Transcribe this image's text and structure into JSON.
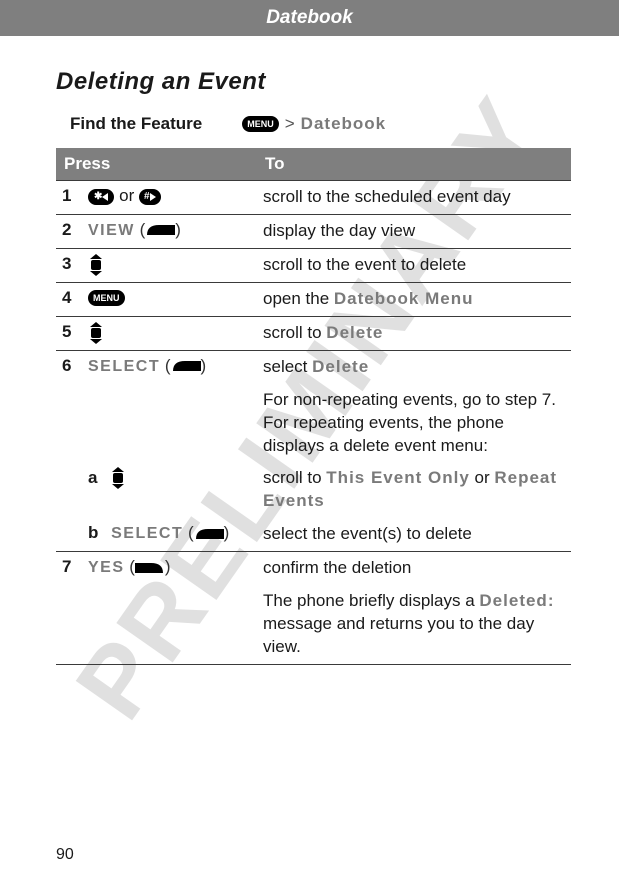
{
  "watermark": "PRELIMINARY",
  "header": {
    "title": "Datebook"
  },
  "section": {
    "heading": "Deleting an  Event"
  },
  "find": {
    "label": "Find the Feature",
    "menu_key_label": "MENU",
    "gt": ">",
    "path_end": "Datebook"
  },
  "table": {
    "col_press": "Press",
    "col_to": "To"
  },
  "icons": {
    "star": "✱",
    "hash": "#",
    "or": "or"
  },
  "steps": {
    "s1": {
      "n": "1",
      "to": "scroll to the scheduled event day"
    },
    "s2": {
      "n": "2",
      "press": "VIEW",
      "to": "display the day view"
    },
    "s3": {
      "n": "3",
      "to": "scroll to the event to delete"
    },
    "s4": {
      "n": "4",
      "to_a": "open the ",
      "to_b": "Datebook Menu"
    },
    "s5": {
      "n": "5",
      "to_a": "scroll to ",
      "to_b": "Delete"
    },
    "s6": {
      "n": "6",
      "press": "SELECT",
      "to_a": "select ",
      "to_b": "Delete",
      "note": "For non-repeating events, go to step 7. For repeating events, the phone displays a delete event menu:"
    },
    "s6a": {
      "n": "a",
      "to_a": "scroll to ",
      "to_b": "This Event Only",
      "to_c": " or ",
      "to_d": "Repeat Events"
    },
    "s6b": {
      "n": "b",
      "press": "SELECT",
      "to": "select the event(s) to delete"
    },
    "s7": {
      "n": "7",
      "press": "YES",
      "to": "confirm the deletion",
      "note_a": "The phone briefly displays a ",
      "note_b": "Deleted:",
      "note_c": " message and returns you to the day view."
    }
  },
  "page_number": "90"
}
